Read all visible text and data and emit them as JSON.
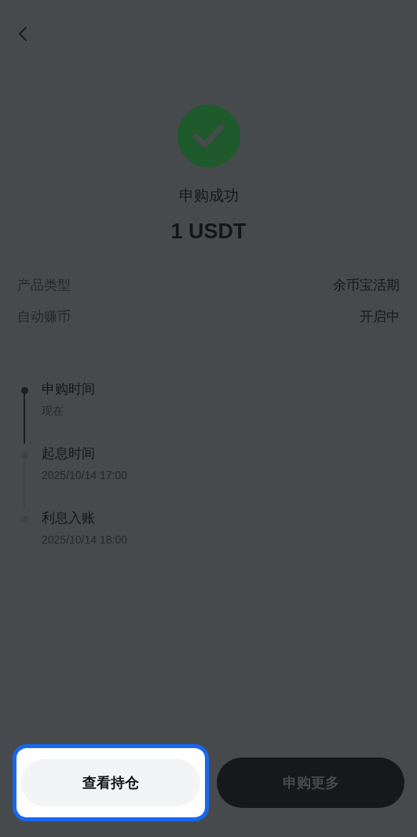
{
  "result": {
    "title": "申购成功",
    "amount": "1 USDT"
  },
  "details": [
    {
      "label": "产品类型",
      "value": "余币宝活期"
    },
    {
      "label": "自动赚币",
      "value": "开启中"
    }
  ],
  "timeline": [
    {
      "title": "申购时间",
      "time": "现在",
      "reached": true
    },
    {
      "title": "起息时间",
      "time": "2025/10/14 17:00",
      "reached": false
    },
    {
      "title": "利息入账",
      "time": "2025/10/14 18:00",
      "reached": false
    }
  ],
  "buttons": [
    {
      "label": "查看持仓",
      "highlighted": true
    },
    {
      "label": "申购更多",
      "highlighted": false
    }
  ]
}
